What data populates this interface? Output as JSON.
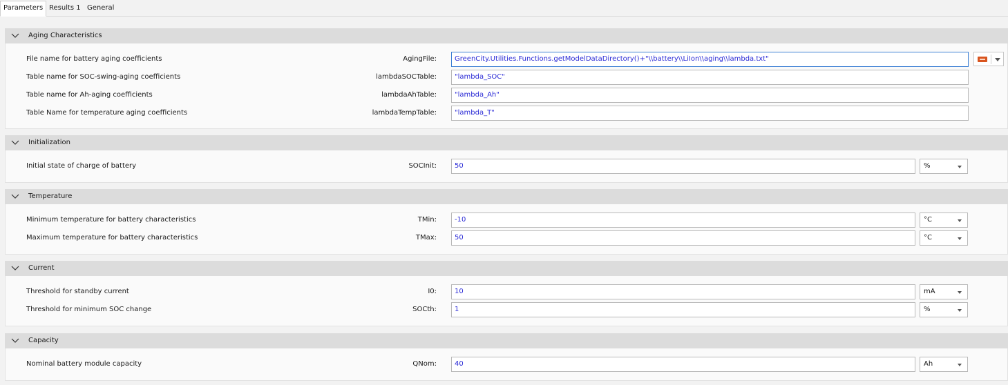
{
  "tabs": [
    {
      "label": "Parameters"
    },
    {
      "label": "Results 1"
    },
    {
      "label": "General"
    }
  ],
  "sections": [
    {
      "title": "Aging Characteristics",
      "rows": [
        {
          "description": "File name for battery aging coefficients",
          "param": "AgingFile:",
          "value": "GreenCity.Utilities.Functions.getModelDataDirectory()+\"\\\\battery\\\\LiIon\\\\aging\\\\lambda.txt\"",
          "unit": ""
        },
        {
          "description": "Table name for SOC-swing-aging coefficients",
          "param": "lambdaSOCTable:",
          "value": "\"lambda_SOC\"",
          "unit": ""
        },
        {
          "description": "Table name for Ah-aging coefficients",
          "param": "lambdaAhTable:",
          "value": "\"lambda_Ah\"",
          "unit": ""
        },
        {
          "description": "Table Name for temperature aging coefficients",
          "param": "lambdaTempTable:",
          "value": "\"lambda_T\"",
          "unit": ""
        }
      ]
    },
    {
      "title": "Initialization",
      "rows": [
        {
          "description": "Initial state of charge of battery",
          "param": "SOCInit:",
          "value": "50",
          "unit": "%"
        }
      ]
    },
    {
      "title": "Temperature",
      "rows": [
        {
          "description": "Minimum temperature for battery characteristics",
          "param": "TMin:",
          "value": "-10",
          "unit": "°C"
        },
        {
          "description": "Maximum temperature for battery characteristics",
          "param": "TMax:",
          "value": "50",
          "unit": "°C"
        }
      ]
    },
    {
      "title": "Current",
      "rows": [
        {
          "description": "Threshold for standby current",
          "param": "I0:",
          "value": "10",
          "unit": "mA"
        },
        {
          "description": "Threshold for minimum SOC change",
          "param": "SOCth:",
          "value": "1",
          "unit": "%"
        }
      ]
    },
    {
      "title": "Capacity",
      "rows": [
        {
          "description": "Nominal battery module capacity",
          "param": "QNom:",
          "value": "40",
          "unit": "Ah"
        }
      ]
    }
  ],
  "icons": {
    "collapse": "chevron-down-icon",
    "file_string": "abc-string-icon"
  },
  "colors": {
    "value_text": "#2b2bd6",
    "header_bg": "#dcdcdc",
    "focus_border": "#3c7fd4",
    "abc_icon": "#d9541e"
  }
}
